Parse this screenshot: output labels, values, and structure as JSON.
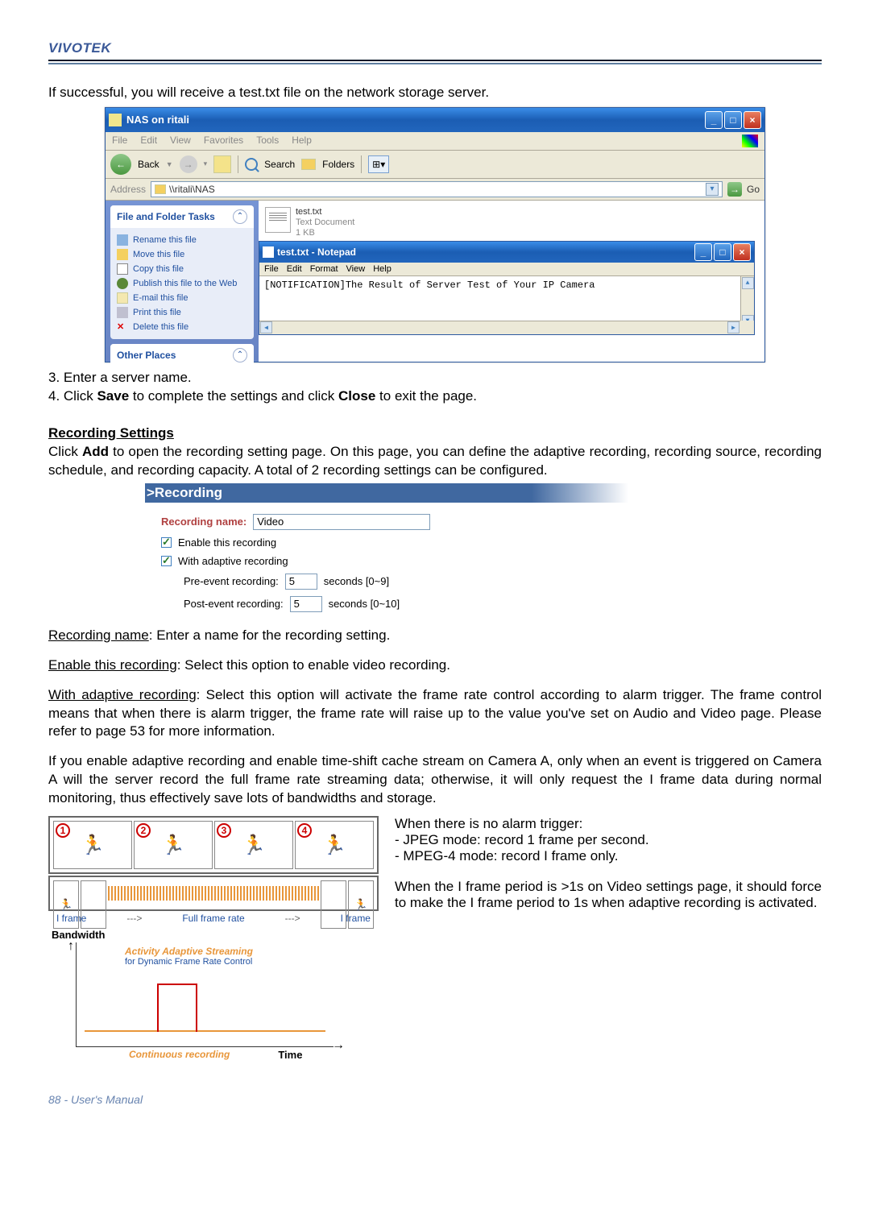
{
  "brand": "VIVOTEK",
  "intro": "If successful, you will receive a test.txt file on the network storage server.",
  "explorer": {
    "title": "NAS on ritali",
    "menu": [
      "File",
      "Edit",
      "View",
      "Favorites",
      "Tools",
      "Help"
    ],
    "back": "Back",
    "search": "Search",
    "folders": "Folders",
    "addressLabel": "Address",
    "address": "\\\\ritali\\NAS",
    "go": "Go",
    "panel1Title": "File and Folder Tasks",
    "tasks": [
      "Rename this file",
      "Move this file",
      "Copy this file",
      "Publish this file to the Web",
      "E-mail this file",
      "Print this file",
      "Delete this file"
    ],
    "panel2Title": "Other Places",
    "file": {
      "name": "test.txt",
      "type": "Text Document",
      "size": "1 KB"
    }
  },
  "notepad": {
    "title": "test.txt - Notepad",
    "menu": [
      "File",
      "Edit",
      "Format",
      "View",
      "Help"
    ],
    "content": "[NOTIFICATION]The Result of Server Test of Your IP Camera"
  },
  "steps": {
    "s3": "3. Enter a server name.",
    "s4a": "4. Click ",
    "s4b": "Save",
    "s4c": " to complete the settings and click ",
    "s4d": "Close",
    "s4e": " to exit the page."
  },
  "recHeading": "Recording Settings",
  "recIntroA": "Click ",
  "recAdd": "Add",
  "recIntroB": " to open the recording setting page. On this page, you can define the adaptive recording, recording source, recording schedule, and recording capacity. A total of 2 recording settings can be configured.",
  "headerBar": ">Recording",
  "form": {
    "nameLabel": "Recording name:",
    "nameValue": "Video",
    "enable": "Enable this recording",
    "adaptive": "With adaptive recording",
    "preLabel": "Pre-event recording:",
    "preVal": "5",
    "preRange": "seconds [0~9]",
    "postLabel": "Post-event recording:",
    "postVal": "5",
    "postRange": "seconds [0~10]"
  },
  "desc": {
    "recName": "Recording name",
    "recNameTxt": ": Enter a name for the recording setting.",
    "enable": "Enable this recording",
    "enableTxt": ": Select this option to enable video recording.",
    "adaptive": "With adaptive recording",
    "adaptiveTxt": ": Select this option will activate the frame rate control according to alarm trigger. The frame control means that when there is alarm trigger, the frame rate will raise up to the value you've set on Audio and Video page. Please refer to page 53 for more information.",
    "para2": "If you enable adaptive recording and enable time-shift cache stream on Camera A, only when an event is triggered on Camera A will the server record the full frame rate streaming data; otherwise, it will only request the I frame data during normal monitoring, thus effectively save lots of bandwidths and storage."
  },
  "diagram": {
    "iframe1": "I frame",
    "fullrate": "Full frame rate",
    "iframe2": "I frame",
    "arrow": "--->",
    "bandwidth": "Bandwidth",
    "annotTitle": "Activity Adaptive Streaming",
    "annotSub": "for Dynamic Frame Rate Control",
    "continuous": "Continuous recording",
    "time": "Time"
  },
  "notes": {
    "noAlarm": "When there is no alarm trigger:",
    "jpeg": "- JPEG mode: record 1 frame per second.",
    "mpeg": "- MPEG-4 mode: record I frame only.",
    "iframe": "When the I frame period is >1s on Video settings page, it should force to make the I frame period to 1s when adaptive recording is activated."
  },
  "footer": "88 - User's Manual"
}
